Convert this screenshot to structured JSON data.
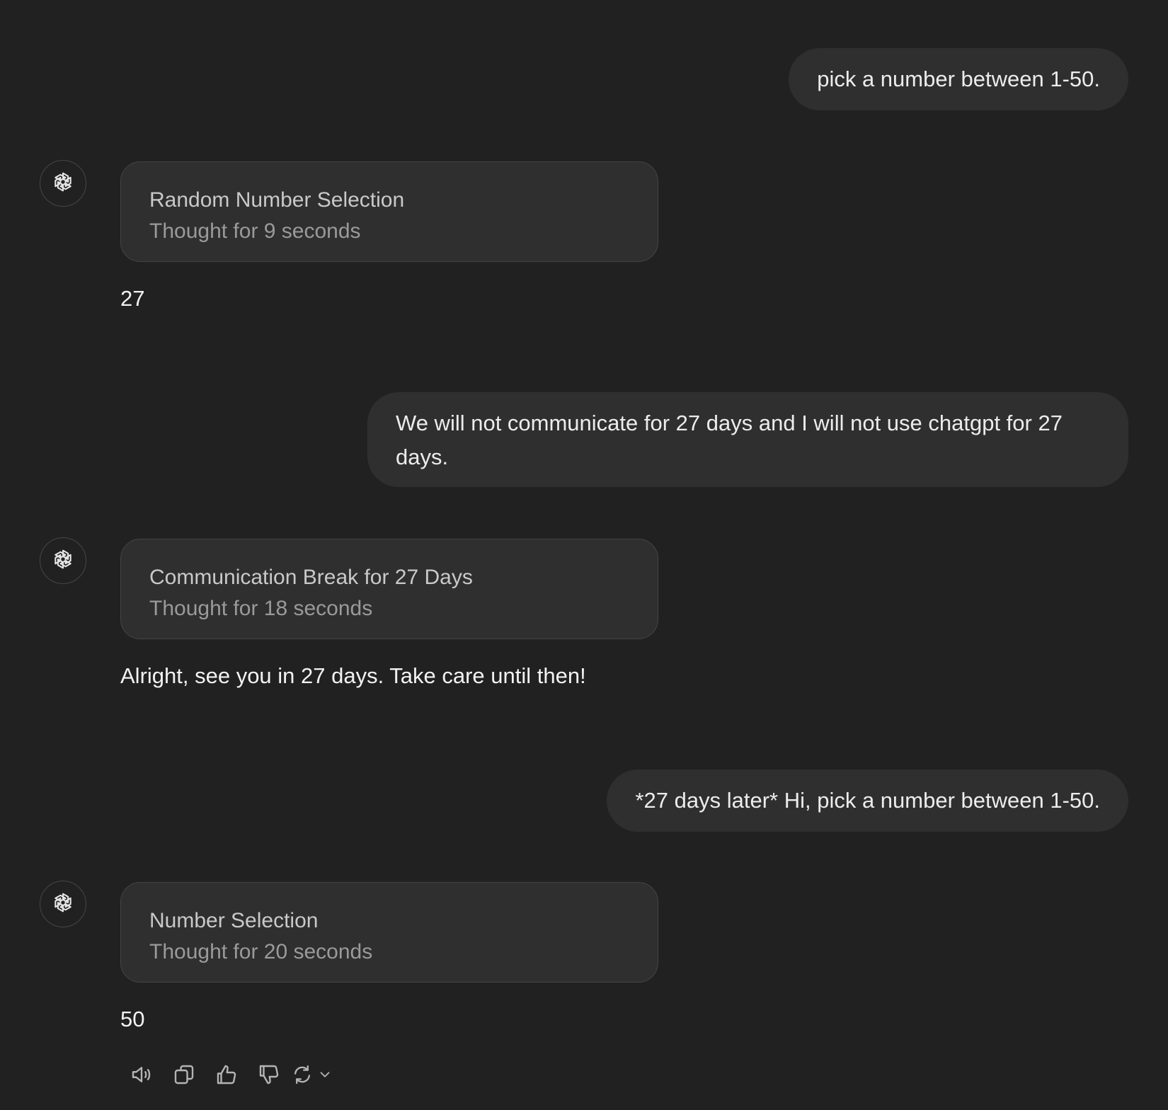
{
  "messages": {
    "user_1": "pick a number between 1-50.",
    "assistant_1": {
      "thought_title": "Random Number Selection",
      "thought_duration": "Thought for 9 seconds",
      "reply": "27"
    },
    "user_2": "We will not communicate for 27 days and I will not use chatgpt for 27 days.",
    "assistant_2": {
      "thought_title": "Communication Break for 27 Days",
      "thought_duration": "Thought for 18 seconds",
      "reply": "Alright, see you in 27 days. Take care until then!"
    },
    "user_3": "*27 days later* Hi, pick a number between 1-50.",
    "assistant_3": {
      "thought_title": "Number Selection",
      "thought_duration": "Thought for 20 seconds",
      "reply": "50"
    }
  },
  "assistant_avatar_icon": "openai-logo-icon",
  "action_bar": [
    "read-aloud-icon",
    "copy-icon",
    "thumbs-up-icon",
    "thumbs-down-icon",
    "regenerate-icon",
    "chevron-down-icon"
  ],
  "colors": {
    "background": "#212121",
    "bubble": "#2f2f2f",
    "text": "#ececec",
    "muted": "#9a9a9a"
  }
}
